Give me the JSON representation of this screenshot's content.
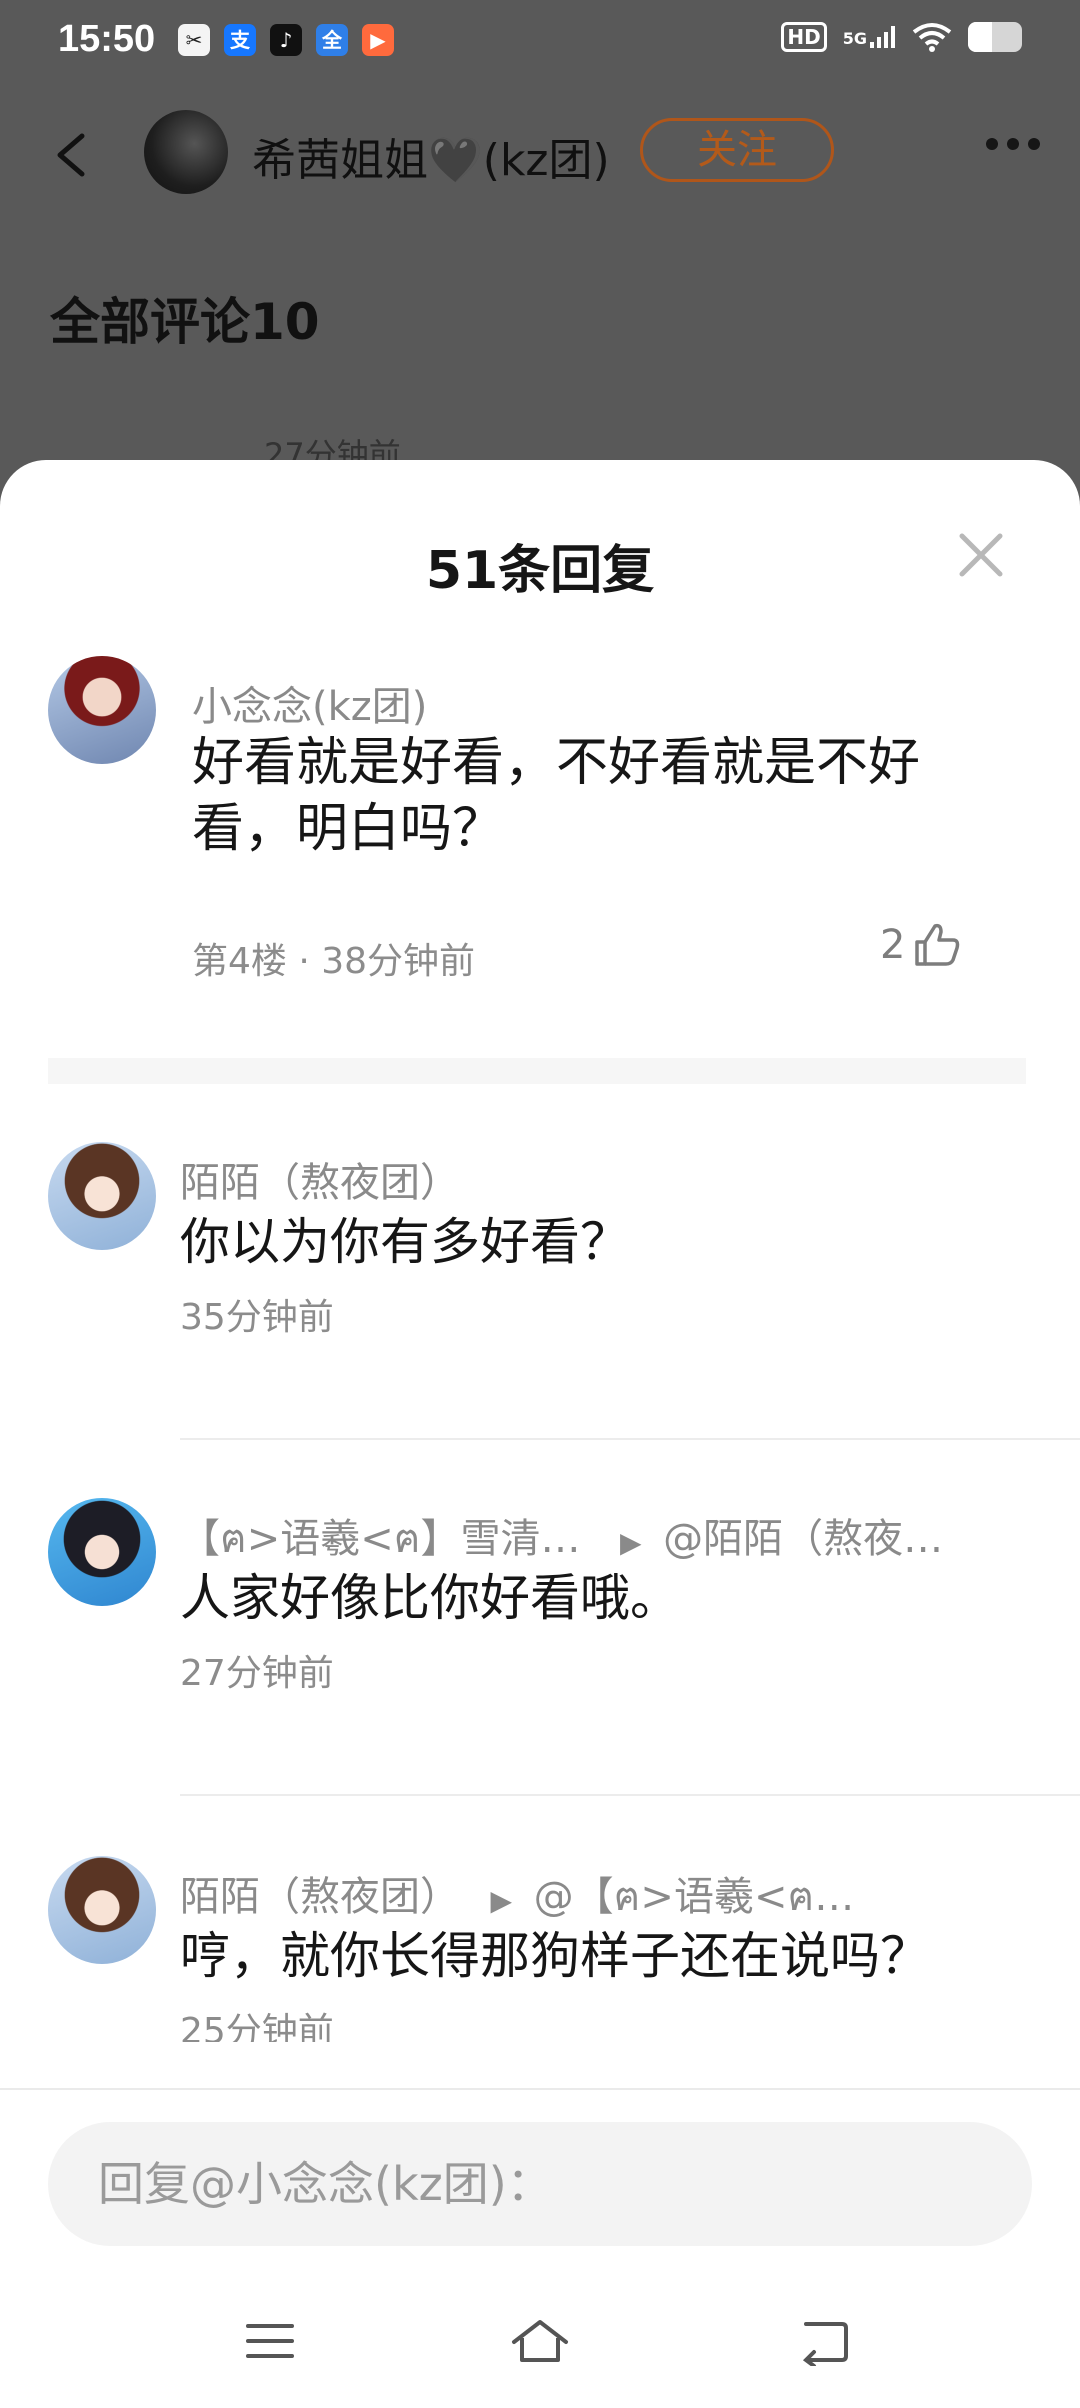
{
  "status_bar": {
    "time": "15:50",
    "notifications": [
      "✂",
      "支",
      "♪",
      "全",
      "▶"
    ],
    "hd_label": "HD",
    "signal_label": "5G",
    "battery_level": 0.45
  },
  "post_header": {
    "author_name": "希茜姐姐🖤(kz团)",
    "follow_label": "关注"
  },
  "comments_section": {
    "title": "全部评论10",
    "partial_time": "27分钟前"
  },
  "sheet": {
    "title": "51条回复",
    "main_comment": {
      "name": "小念念(kz团)",
      "text": "好看就是好看，不好看就是不好看，明白吗？",
      "meta": "第4楼 · 38分钟前",
      "like_count": "2"
    },
    "replies": [
      {
        "name": "陌陌（熬夜团）",
        "target": "",
        "text": "你以为你有多好看？",
        "time": "35分钟前"
      },
      {
        "name": "【ฅ>语羲<ฅ】雪清…",
        "target": "@陌陌（熬夜…",
        "text": "人家好像比你好看哦。",
        "time": "27分钟前"
      },
      {
        "name": "陌陌（熬夜团）",
        "target": "@【ฅ>语羲<ฅ…",
        "text": "哼，就你长得那狗样子还在说吗？",
        "time": "25分钟前"
      }
    ]
  },
  "reply_input": {
    "placeholder": "回复@小念念(kz团)："
  },
  "icons": {
    "back": "back-arrow-icon",
    "more": "more-dots-icon",
    "close": "close-icon",
    "like": "thumbs-up-icon",
    "nav_menu": "menu-icon",
    "nav_home": "home-icon",
    "nav_back": "back-icon"
  },
  "colors": {
    "follow": "#b35a1a",
    "sheet_bg": "#ffffff",
    "dim_bg": "#595959"
  }
}
